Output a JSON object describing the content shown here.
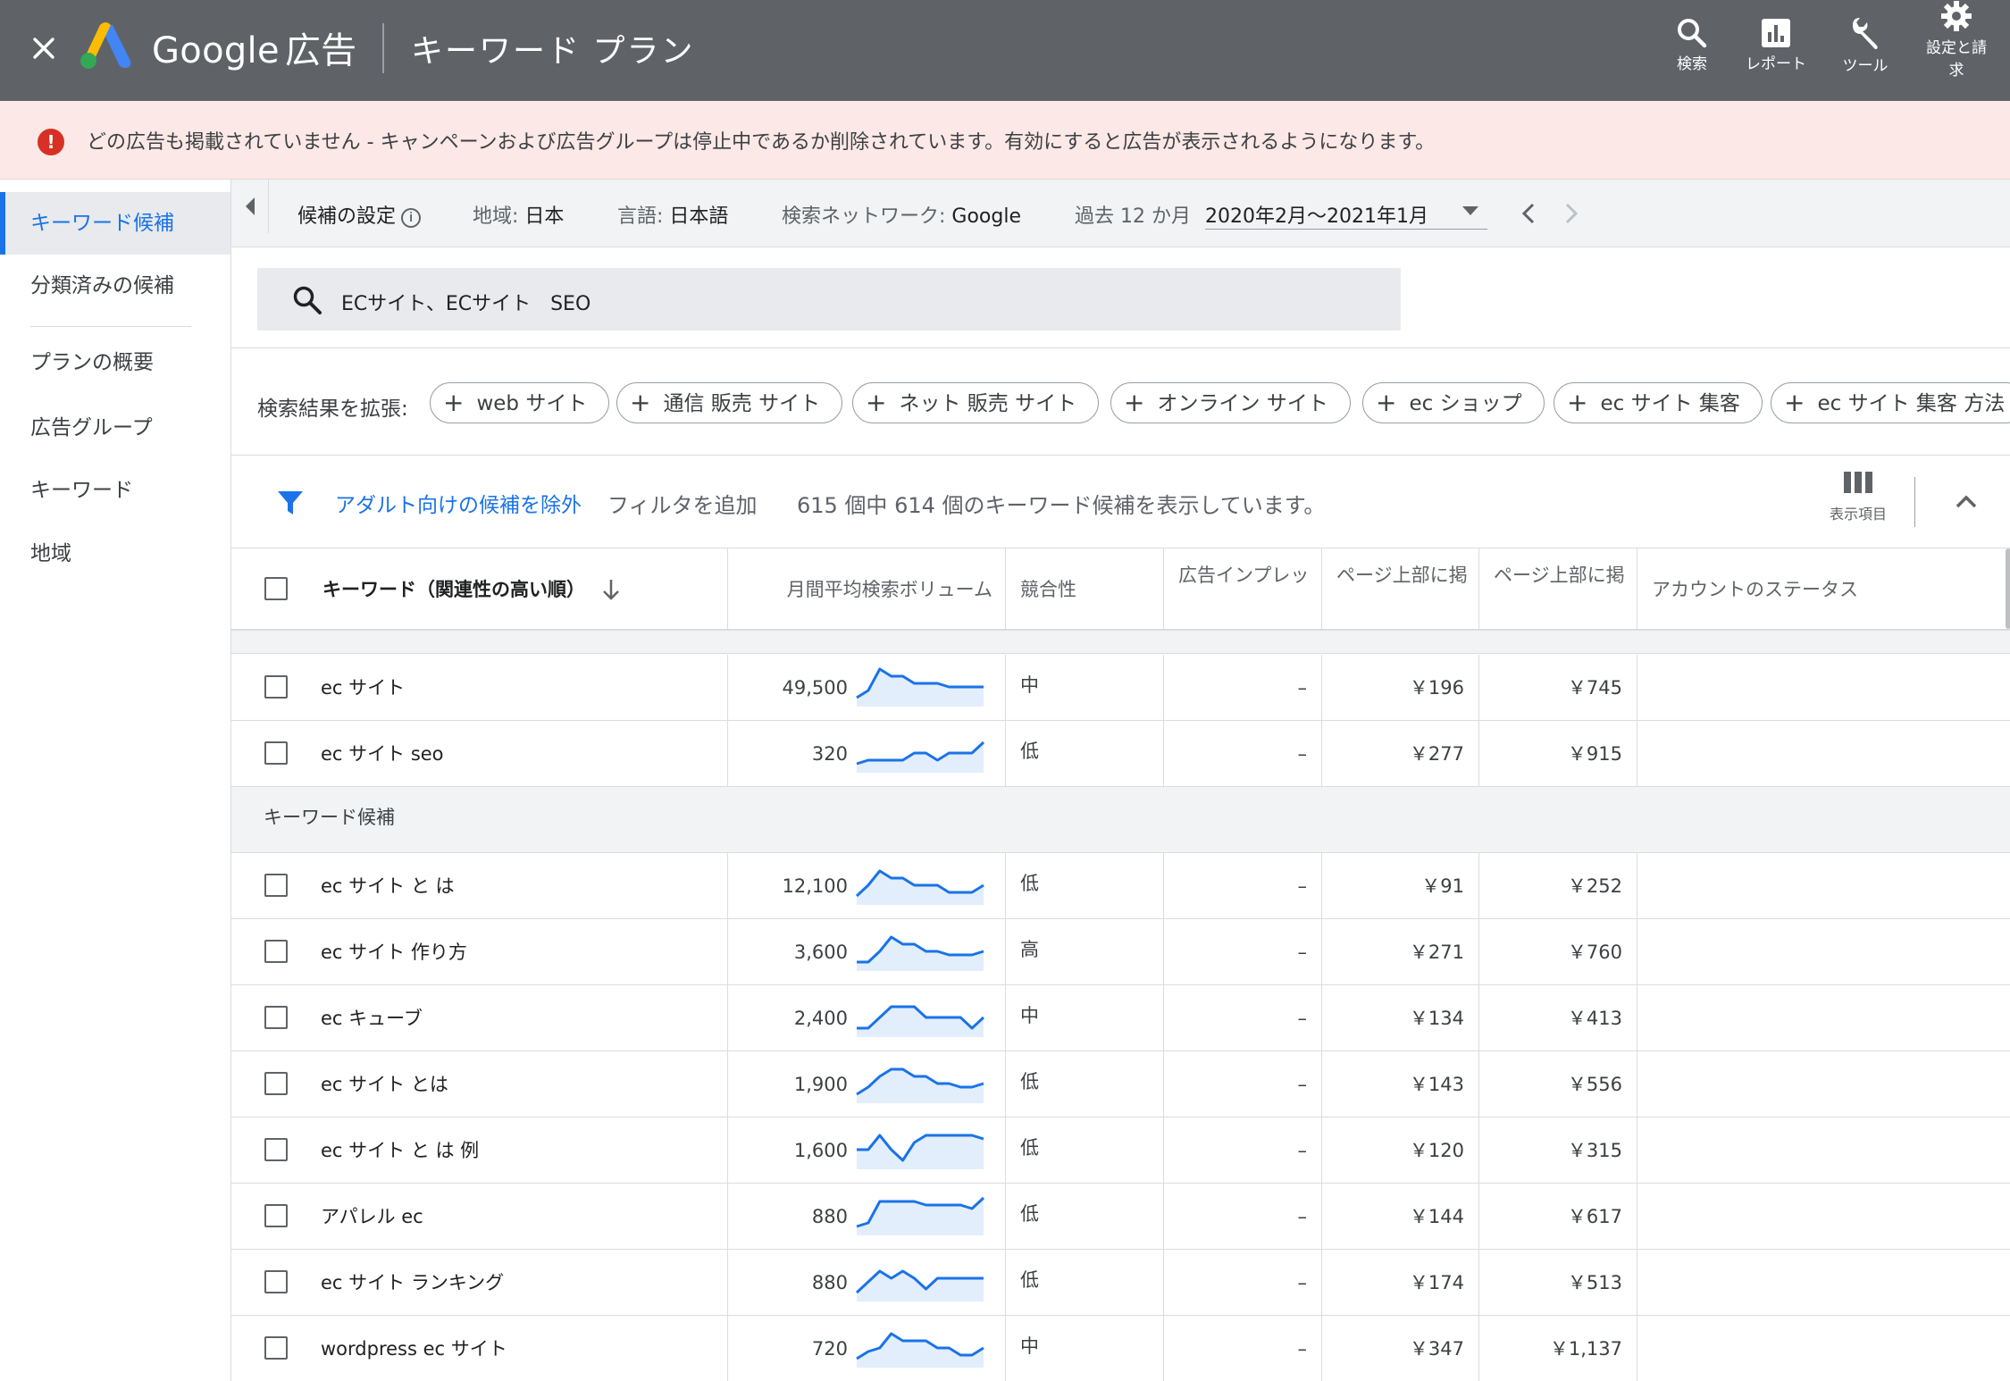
{
  "topbar": {
    "brand_primary": "Google",
    "brand_secondary": "広告",
    "app_title": "キーワード プラン",
    "nav": [
      {
        "label": "検索",
        "icon": "search-icon"
      },
      {
        "label": "レポート",
        "icon": "report-icon"
      },
      {
        "label": "ツール",
        "icon": "wrench-icon"
      },
      {
        "label": "設定と請\n求",
        "icon": "gear-icon"
      }
    ]
  },
  "alert": {
    "icon": "error-icon",
    "text": "どの広告も掲載されていません - キャンペーンおよび広告グループは停止中であるか削除されています。有効にすると広告が表示されるようになります。"
  },
  "sidebar": {
    "items": [
      {
        "label": "キーワード候補",
        "active": true
      },
      {
        "label": "分類済みの候補",
        "active": false
      },
      {
        "label": "プランの概要",
        "active": false
      },
      {
        "label": "広告グループ",
        "active": false
      },
      {
        "label": "キーワード",
        "active": false
      },
      {
        "label": "地域",
        "active": false
      }
    ]
  },
  "settings_bar": {
    "title": "候補の設定",
    "location_label": "地域:",
    "location_value": "日本",
    "language_label": "言語:",
    "language_value": "日本語",
    "network_label": "検索ネットワーク:",
    "network_value": "Google",
    "period_label": "過去 12 か月",
    "period_value": "2020年2月～2021年1月"
  },
  "search": {
    "value": "ECサイト、ECサイト　SEO"
  },
  "expand": {
    "label": "検索結果を拡張:",
    "chips": [
      "web サイト",
      "通信 販売 サイト",
      "ネット 販売 サイト",
      "オンライン サイト",
      "ec ショップ",
      "ec サイト 集客",
      "ec サイト 集客 方法"
    ]
  },
  "filter": {
    "exclude_adult": "アダルト向けの候補を除外",
    "add_filter": "フィルタを追加",
    "count_text": "615 個中 614 個のキーワード候補を表示しています。",
    "columns_label": "表示項目"
  },
  "table": {
    "headers": {
      "keyword": "キーワード（関連性の高い順）",
      "volume": "月間平均検索ボリューム",
      "competition": "競合性",
      "impression_share": "広告インプレッ",
      "bid_low": "ページ上部に掲",
      "bid_high": "ページ上部に掲",
      "account_status": "アカウントのステータス"
    },
    "section_label": "キーワード候補",
    "provided_rows": [
      {
        "keyword": "ec サイト",
        "volume": "49,500",
        "competition": "中",
        "impression": "–",
        "bid_low": "￥196",
        "bid_high": "￥745",
        "trend": [
          2,
          4,
          10,
          8,
          8,
          6,
          6,
          6,
          5,
          5,
          5,
          5
        ]
      },
      {
        "keyword": "ec サイト seo",
        "volume": "320",
        "competition": "低",
        "impression": "–",
        "bid_low": "￥277",
        "bid_high": "￥915",
        "trend": [
          2,
          3,
          3,
          3,
          3,
          5,
          5,
          3,
          5,
          5,
          5,
          8
        ]
      }
    ],
    "idea_rows": [
      {
        "keyword": "ec サイト と は",
        "volume": "12,100",
        "competition": "低",
        "impression": "–",
        "bid_low": "￥91",
        "bid_high": "￥252",
        "trend": [
          2,
          5,
          9,
          7,
          7,
          5,
          5,
          5,
          3,
          3,
          3,
          5
        ]
      },
      {
        "keyword": "ec サイト 作り方",
        "volume": "3,600",
        "competition": "高",
        "impression": "–",
        "bid_low": "￥271",
        "bid_high": "￥760",
        "trend": [
          2,
          2,
          5,
          9,
          7,
          7,
          5,
          5,
          4,
          4,
          4,
          5
        ]
      },
      {
        "keyword": "ec キューブ",
        "volume": "2,400",
        "competition": "中",
        "impression": "–",
        "bid_low": "￥134",
        "bid_high": "￥413",
        "trend": [
          2,
          2,
          5,
          8,
          8,
          8,
          5,
          5,
          5,
          5,
          2,
          5
        ]
      },
      {
        "keyword": "ec サイト とは",
        "volume": "1,900",
        "competition": "低",
        "impression": "–",
        "bid_low": "￥143",
        "bid_high": "￥556",
        "trend": [
          2,
          4,
          7,
          9,
          9,
          7,
          7,
          5,
          5,
          4,
          4,
          5
        ]
      },
      {
        "keyword": "ec サイト と は 例",
        "volume": "1,600",
        "competition": "低",
        "impression": "–",
        "bid_low": "￥120",
        "bid_high": "￥315",
        "trend": [
          5,
          5,
          9,
          5,
          2,
          7,
          9,
          9,
          9,
          9,
          9,
          8
        ]
      },
      {
        "keyword": "アパレル ec",
        "volume": "880",
        "competition": "低",
        "impression": "–",
        "bid_low": "￥144",
        "bid_high": "￥617",
        "trend": [
          2,
          3,
          9,
          9,
          9,
          9,
          8,
          8,
          8,
          8,
          7,
          10
        ]
      },
      {
        "keyword": "ec サイト ランキング",
        "volume": "880",
        "competition": "低",
        "impression": "–",
        "bid_low": "￥174",
        "bid_high": "￥513",
        "trend": [
          2,
          5,
          8,
          6,
          8,
          6,
          3,
          6,
          6,
          6,
          6,
          6
        ]
      },
      {
        "keyword": "wordpress ec サイト",
        "volume": "720",
        "competition": "中",
        "impression": "–",
        "bid_low": "￥347",
        "bid_high": "￥1,137",
        "trend": [
          2,
          4,
          5,
          9,
          7,
          7,
          7,
          5,
          5,
          3,
          3,
          5
        ]
      }
    ]
  }
}
